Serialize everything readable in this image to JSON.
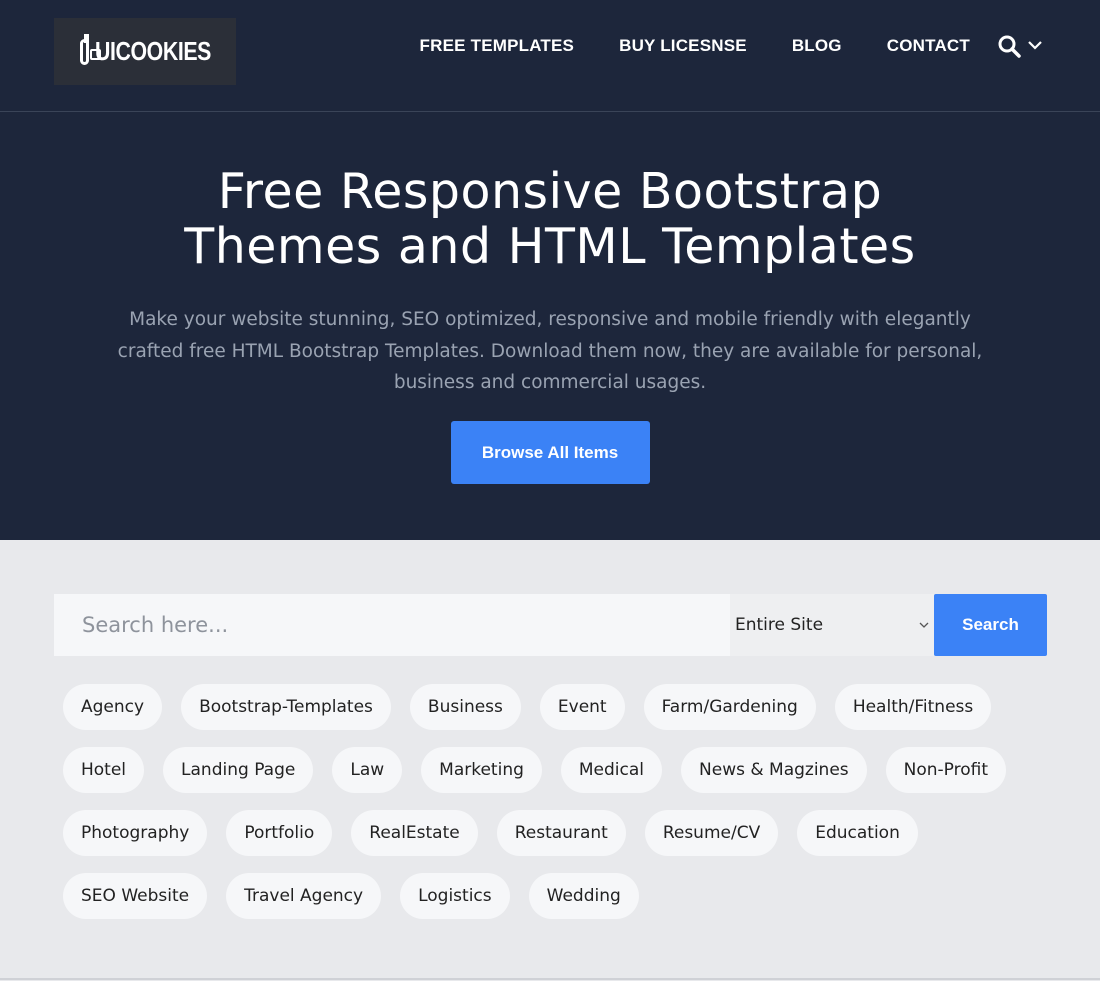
{
  "brand": {
    "name": "UICOOKIES"
  },
  "nav": {
    "items": [
      "FREE TEMPLATES",
      "BUY LICESNSE",
      "BLOG",
      "CONTACT"
    ]
  },
  "hero": {
    "title_line1": "Free Responsive Bootstrap",
    "title_line2": "Themes and HTML Templates",
    "subtitle": "Make your website stunning, SEO optimized, responsive and mobile friendly with elegantly crafted free HTML Bootstrap Templates. Download them now, they are available for personal, business and commercial usages.",
    "button_label": "Browse All Items"
  },
  "search": {
    "placeholder": "Search here...",
    "scope_selected": "Entire Site",
    "button_label": "Search"
  },
  "tags": [
    [
      "Agency",
      "Bootstrap-Templates",
      "Business",
      "Event",
      "Farm/Gardening",
      "Health/Fitness"
    ],
    [
      "Hotel",
      "Landing Page",
      "Law",
      "Marketing",
      "Medical",
      "News & Magzines",
      "Non-Profit"
    ],
    [
      "Photography",
      "Portfolio",
      "RealEstate",
      "Restaurant",
      "Resume/CV",
      "Education"
    ],
    [
      "SEO Website",
      "Travel Agency",
      "Logistics",
      "Wedding"
    ]
  ],
  "colors": {
    "header_bg": "#1d263b",
    "accent": "#3b82f6",
    "page_bg": "#e8e9ec"
  },
  "icons": {
    "search": "search-icon",
    "dropdown": "chevron-down-icon"
  }
}
